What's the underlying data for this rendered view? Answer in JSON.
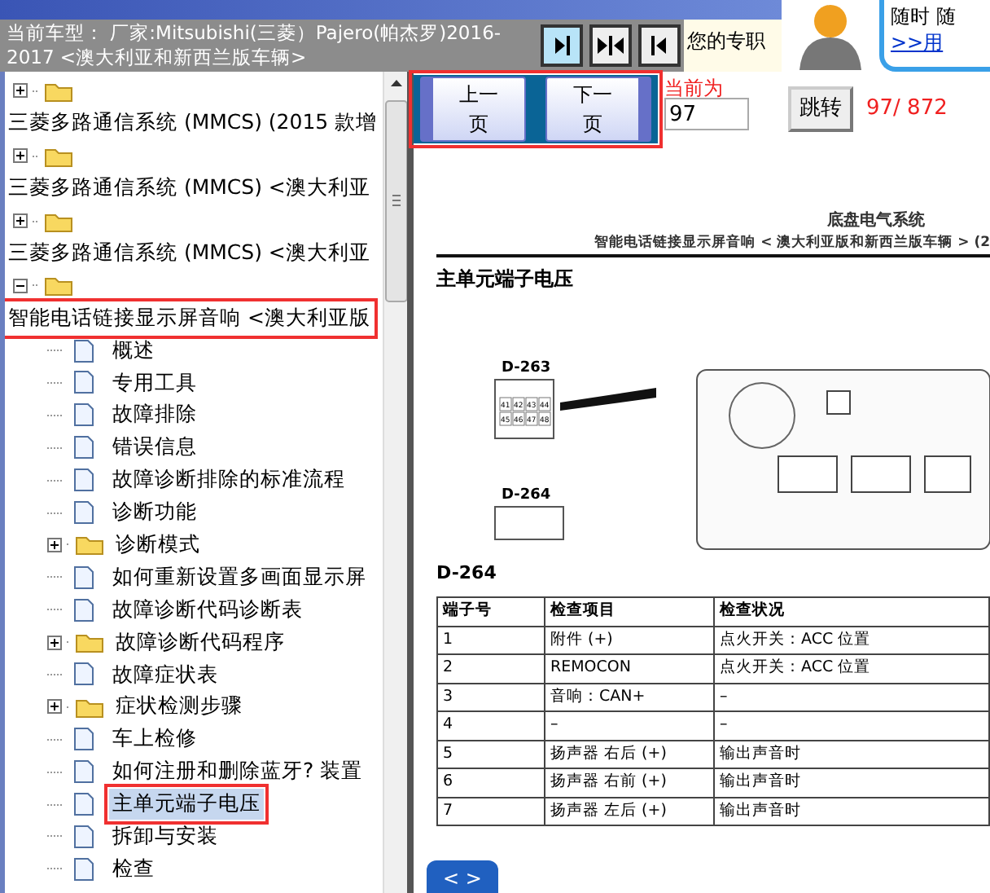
{
  "header": {
    "vehicle": "当前车型： 厂家:Mitsubishi(三菱）Pajero(帕杰罗)2016-2017 <澳大利亚和新西兰版车辆>",
    "notice": "您的专职",
    "promo_text": "随时 随",
    "promo_link": ">>用"
  },
  "tree": [
    {
      "label": "三菱多路通信系统 (MMCS) (2015 款增",
      "kind": "folder",
      "expanded": false,
      "annotated": false
    },
    {
      "label": "三菱多路通信系统 (MMCS) <澳大利亚",
      "kind": "folder",
      "expanded": false,
      "annotated": false
    },
    {
      "label": "三菱多路通信系统 (MMCS) <澳大利亚",
      "kind": "folder",
      "expanded": false,
      "annotated": false
    },
    {
      "label": "智能电话链接显示屏音响 <澳大利亚版",
      "kind": "folder",
      "expanded": true,
      "annotated": true,
      "children": [
        {
          "label": "概述",
          "kind": "page",
          "selected": false
        },
        {
          "label": "专用工具",
          "kind": "page",
          "selected": false
        },
        {
          "label": "故障排除",
          "kind": "page",
          "selected": false
        },
        {
          "label": "错误信息",
          "kind": "page",
          "selected": false
        },
        {
          "label": "故障诊断排除的标准流程",
          "kind": "page",
          "selected": false
        },
        {
          "label": "诊断功能",
          "kind": "page",
          "selected": false
        },
        {
          "label": "诊断模式",
          "kind": "folder",
          "expanded": false,
          "selected": false
        },
        {
          "label": "如何重新设置多画面显示屏",
          "kind": "page",
          "selected": false
        },
        {
          "label": "故障诊断代码诊断表",
          "kind": "page",
          "selected": false
        },
        {
          "label": "故障诊断代码程序",
          "kind": "folder",
          "expanded": false,
          "selected": false
        },
        {
          "label": "故障症状表",
          "kind": "page",
          "selected": false
        },
        {
          "label": "症状检测步骤",
          "kind": "folder",
          "expanded": false,
          "selected": false
        },
        {
          "label": "车上检修",
          "kind": "page",
          "selected": false
        },
        {
          "label": "如何注册和删除蓝牙? 装置",
          "kind": "page",
          "selected": false
        },
        {
          "label": "主单元端子电压",
          "kind": "page",
          "selected": true,
          "annotated": true
        },
        {
          "label": "拆卸与安装",
          "kind": "page",
          "selected": false
        },
        {
          "label": "检查",
          "kind": "page",
          "selected": false
        }
      ]
    }
  ],
  "pager": {
    "prev": "上一页",
    "next": "下一页",
    "annotated": true,
    "current_label": "当前为",
    "page_value": "97",
    "jump": "跳转",
    "count": "97/ 872"
  },
  "document": {
    "section": "底盘电气系统",
    "subtitle": "智能电话链接显示屏音响 < 澳大利亚版和新西兰版车辆 > (2",
    "heading": "主单元端子电压",
    "diagram": {
      "connector_a": "D-263",
      "connector_b": "D-264",
      "pins": [
        "41",
        "42",
        "43",
        "44",
        "45",
        "46",
        "47",
        "48"
      ]
    },
    "table_title": "D-264",
    "columns": [
      "端子号",
      "检查项目",
      "检查状况"
    ],
    "rows": [
      [
        "1",
        "附件 (+)",
        "点火开关：ACC 位置"
      ],
      [
        "2",
        "REMOCON",
        "点火开关：ACC 位置"
      ],
      [
        "3",
        "音响：CAN+",
        "–"
      ],
      [
        "4",
        "–",
        "–"
      ],
      [
        "5",
        "扬声器 右后 (+)",
        "输出声音时"
      ],
      [
        "6",
        "扬声器 右前 (+)",
        "输出声音时"
      ],
      [
        "7",
        "扬声器 左后 (+)",
        "输出声音时"
      ]
    ],
    "nav_button": "< >"
  }
}
